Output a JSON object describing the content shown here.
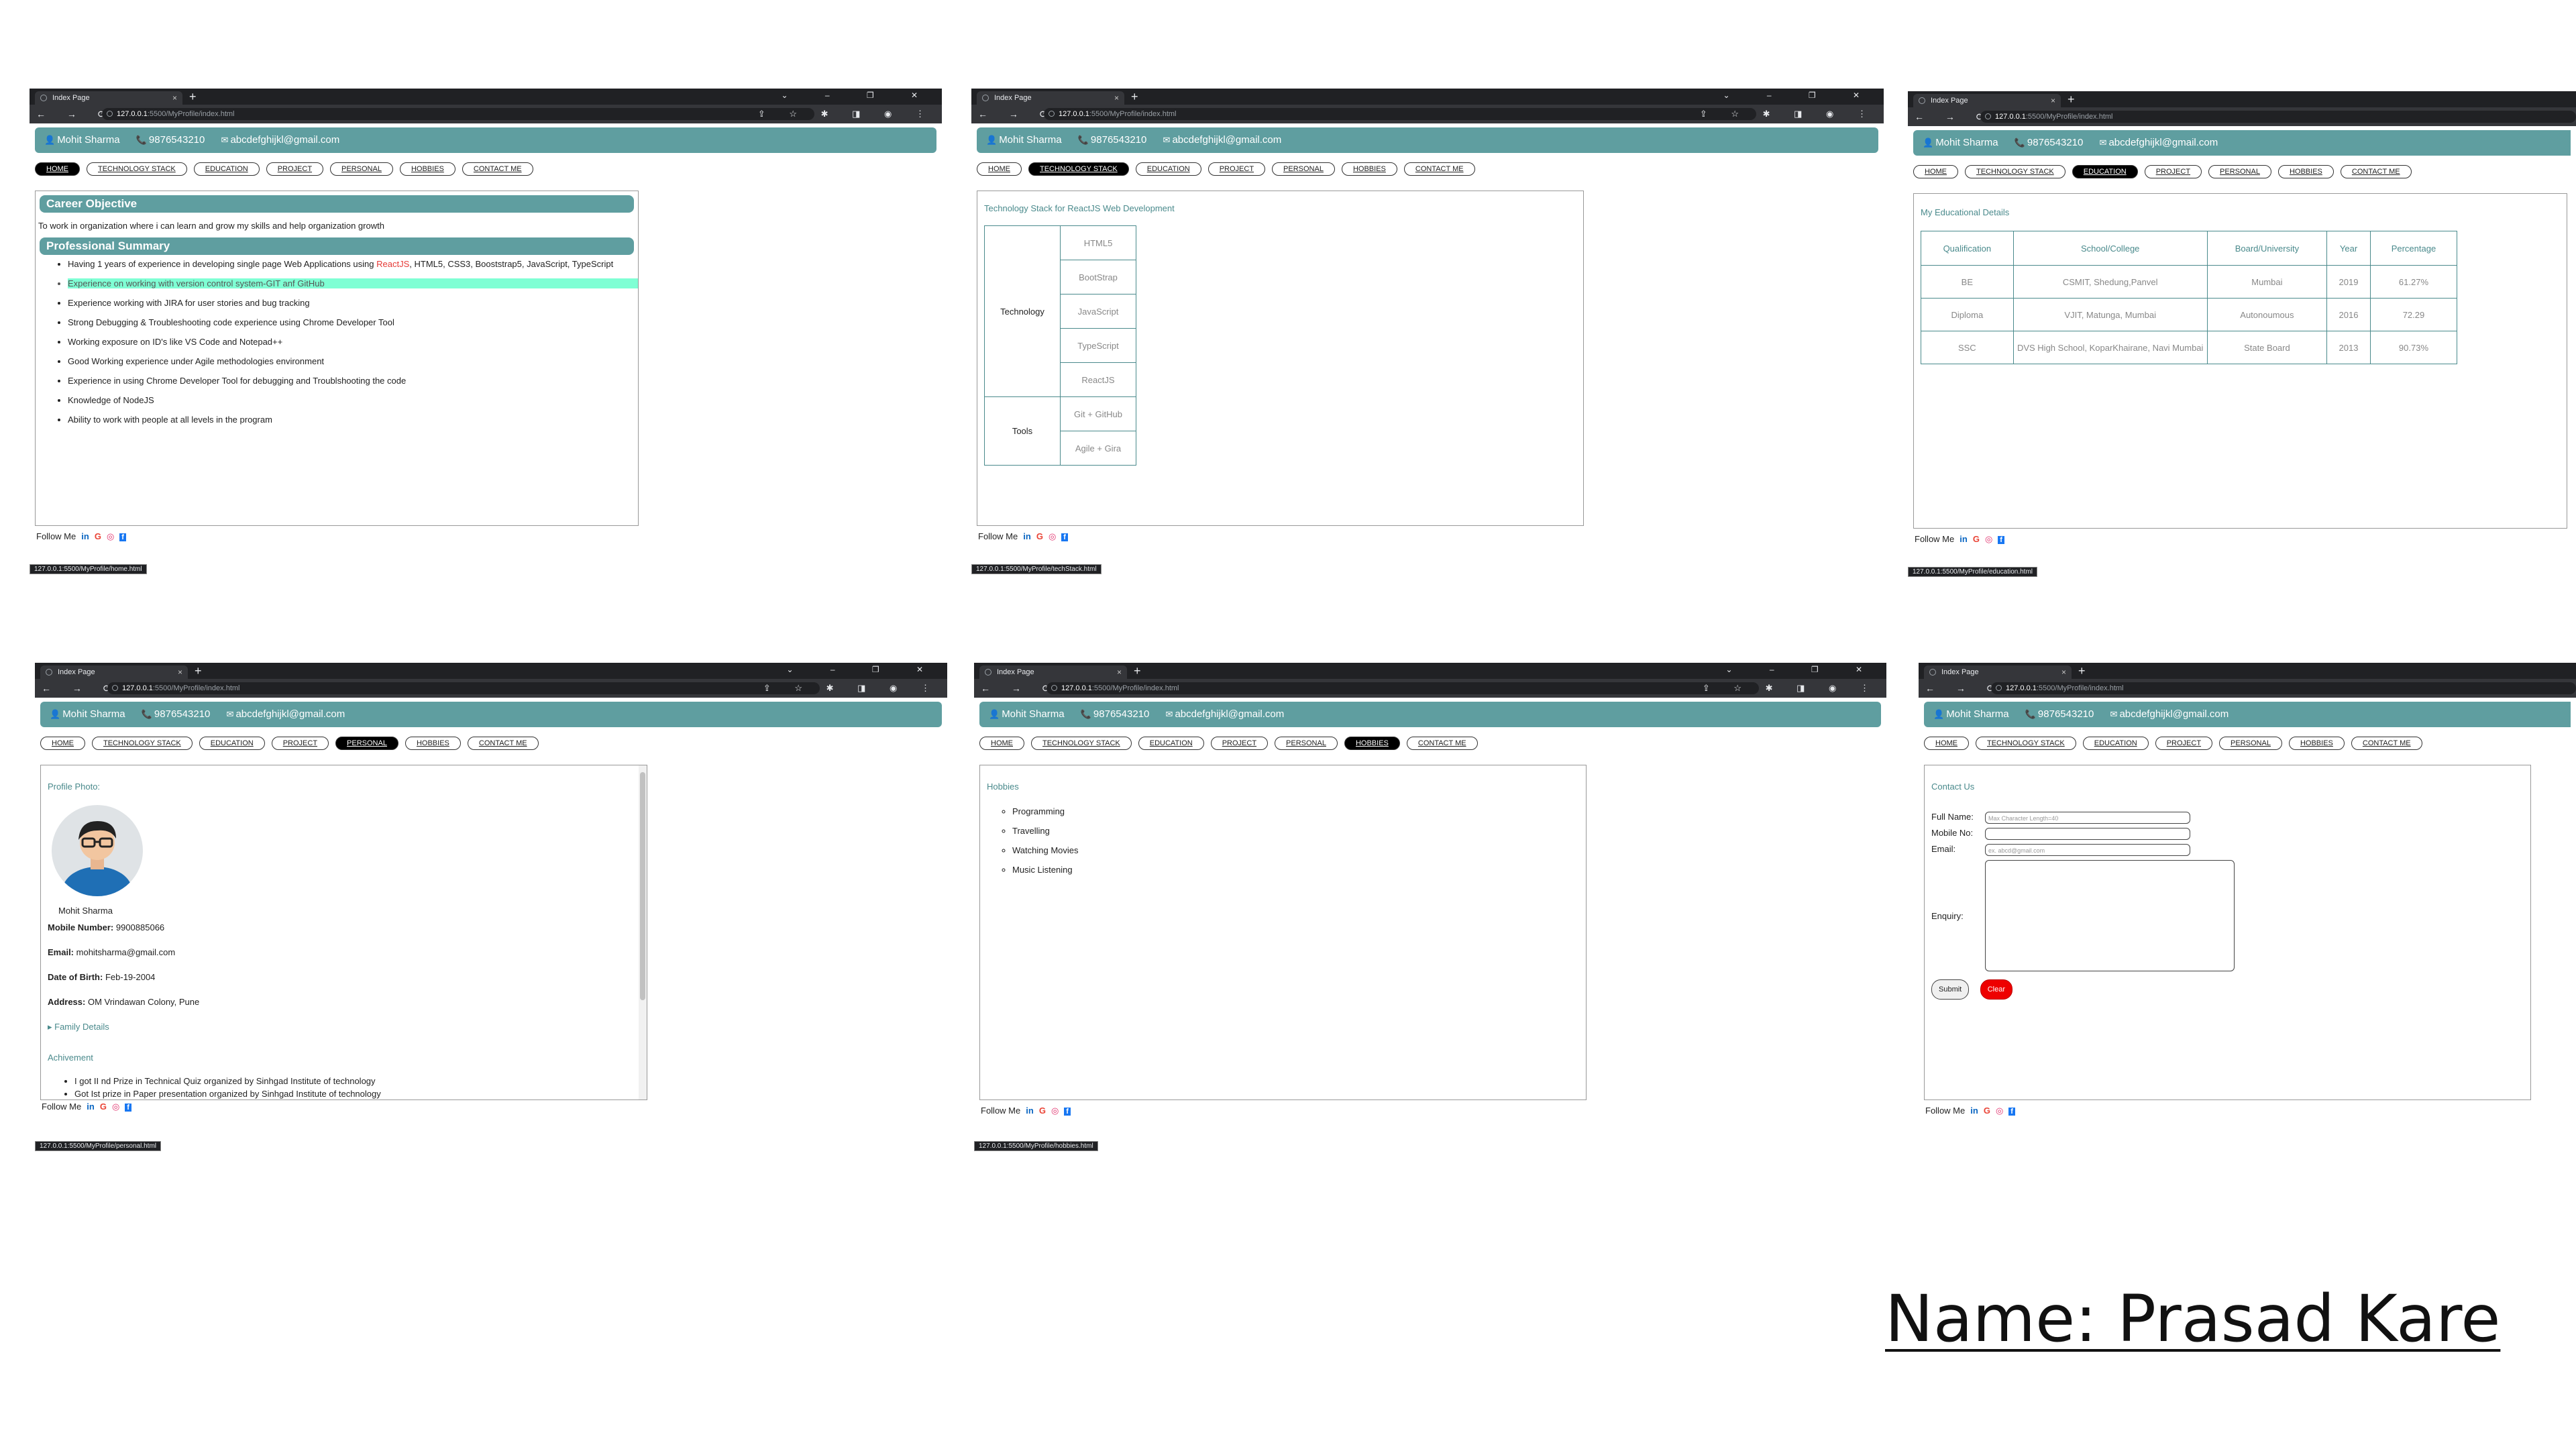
{
  "browser": {
    "tab_title": "Index Page",
    "tab_close": "×",
    "new_tab": "+",
    "window_controls": "⌄ – ❐ ✕",
    "nav_buttons": "← → ⟳",
    "url_host": "127.0.0.1",
    "url_rest": ":5500/MyProfile/index.html",
    "toolbar_icons": "⇪ ☆ ✱ ◨ ◉ ⋮"
  },
  "header": {
    "name": "Mohit Sharma",
    "phone": "9876543210",
    "email": "abcdefghijkl@gmail.com",
    "person_icon": "👤",
    "phone_icon": "📞",
    "mail_icon": "✉"
  },
  "nav": {
    "home": "HOME",
    "tech": "TECHNOLOGY STACK",
    "education": "EDUCATION",
    "project": "PROJECT",
    "personal": "PERSONAL",
    "hobbies": "HOBBIES",
    "contact": "CONTACT ME"
  },
  "footer": {
    "follow": "Follow Me",
    "linkedin": "in",
    "google": "G",
    "instagram": "◎",
    "facebook": "f"
  },
  "status": {
    "home": "127.0.0.1:5500/MyProfile/home.html",
    "tech": "127.0.0.1:5500/MyProfile/techStack.html",
    "education": "127.0.0.1:5500/MyProfile/education.html",
    "personal": "127.0.0.1:5500/MyProfile/personal.html",
    "hobbies": "127.0.0.1:5500/MyProfile/hobbies.html"
  },
  "home": {
    "career_title": "Career Objective",
    "career_text": "To work in organization where i can learn and grow my skills and help organization growth",
    "summary_title": "Professional Summary",
    "item1_pre": "Having 1 years of experience in developing single page Web Applications using ",
    "item1_red": "ReactJS",
    "item1_post": ", HTML5, CSS3, Booststrap5, JavaScript, TypeScript",
    "item2": "Experience on working with version control system-GIT anf GitHub",
    "item3": "Experience working with JIRA for user stories and bug tracking",
    "item4": "Strong Debugging & Troubleshooting code experience using Chrome Developer Tool",
    "item5": "Working exposure on ID's like VS Code and Notepad++",
    "item6": "Good Working experience under Agile methodologies environment",
    "item7": "Experience in using Chrome Developer Tool for debugging and Troublshooting the code",
    "item8": "Knowledge of NodeJS",
    "item9": "Ability to work with people at all levels in the program"
  },
  "tech": {
    "title": "Technology Stack for ReactJS Web Development",
    "technology_label": "Technology",
    "tools_label": "Tools",
    "t1": "HTML5",
    "t2": "BootStrap",
    "t3": "JavaScript",
    "t4": "TypeScript",
    "t5": "ReactJS",
    "t6": "Git + GitHub",
    "t7": "Agile + Gira"
  },
  "education": {
    "title": "My Educational Details",
    "h1": "Qualification",
    "h2": "School/College",
    "h3": "Board/University",
    "h4": "Year",
    "h5": "Percentage",
    "r1c1": "BE",
    "r1c2": "CSMIT, Shedung,Panvel",
    "r1c3": "Mumbai",
    "r1c4": "2019",
    "r1c5": "61.27%",
    "r2c1": "Diploma",
    "r2c2": "VJIT, Matunga, Mumbai",
    "r2c3": "Autonoumous",
    "r2c4": "2016",
    "r2c5": "72.29",
    "r3c1": "SSC",
    "r3c2": "DVS High School, KoparKhairane, Navi Mumbai",
    "r3c3": "State Board",
    "r3c4": "2013",
    "r3c5": "90.73%"
  },
  "personal": {
    "photo_label": "Profile Photo:",
    "name": "Mohit Sharma",
    "mobile_label": "Mobile Number:",
    "mobile": "9900885066",
    "email_label": "Email:",
    "email": "mohitsharma@gmail.com",
    "dob_label": "Date of Birth:",
    "dob": "Feb-19-2004",
    "address_label": "Address:",
    "address": "OM Vrindawan Colony, Pune",
    "family": "▸ Family Details",
    "achievement": "Achivement",
    "ach1": "I got II nd Prize in Technical Quiz organized by Sinhgad Institute of technology",
    "ach2": "Got Ist prize in Paper presentation organized by Sinhgad Institute of technology"
  },
  "hobbies": {
    "title": "Hobbies",
    "h1": "Programming",
    "h2": "Travelling",
    "h3": "Watching Movies",
    "h4": "Music Listening"
  },
  "contact": {
    "title": "Contact Us",
    "fullname_label": "Full Name:",
    "fullname_ph": "Max Character Length=40",
    "mobile_label": "Mobile No:",
    "email_label": "Email:",
    "email_ph": "ex. abcd@gmail.com",
    "enquiry_label": "Enquiry:",
    "submit": "Submit",
    "clear": "Clear"
  },
  "caption": "Name: Prasad Kare",
  "colors": {
    "teal": "#5f9ea0",
    "chrome_dark": "#202124",
    "highlight": "#7fffd4",
    "clear_button": "#ee0000"
  }
}
